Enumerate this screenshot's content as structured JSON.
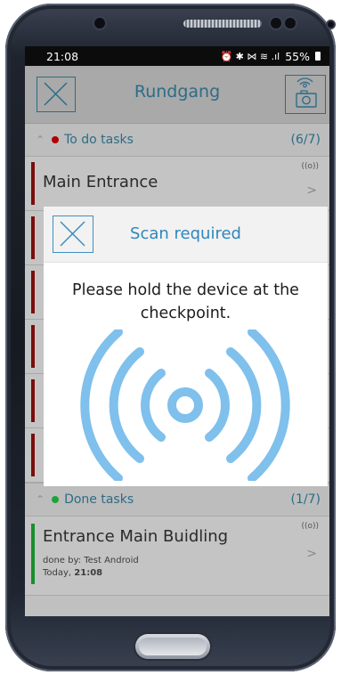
{
  "status_bar": {
    "time": "21:08",
    "icons": "⏰ ✱ ⋈ ≋ .ıl",
    "battery": "55%"
  },
  "app_bar": {
    "title": "Rundgang"
  },
  "todo_section": {
    "label": "To do tasks",
    "count": "(6/7)",
    "dot_color": "#b00000"
  },
  "todo_tasks": [
    {
      "label": "Main Entrance",
      "nfc": "((o))",
      "arrow": ">"
    }
  ],
  "dialog": {
    "title": "Scan required",
    "message": "Please hold the device at the checkpoint.",
    "icon": "nfc-icon"
  },
  "done_section": {
    "label": "Done tasks",
    "count": "(1/7)",
    "dot_color": "#1ea33a"
  },
  "done_tasks": [
    {
      "label": "Entrance Main Buidling",
      "done_by": "done by: Test Android",
      "when_day": "Today, ",
      "when_time": "21:08",
      "nfc": "((o))",
      "arrow": ">"
    }
  ],
  "colors": {
    "accent": "#2d6c86",
    "dialog_accent": "#2f86bb",
    "nfc_blue": "#7fc0ec"
  }
}
